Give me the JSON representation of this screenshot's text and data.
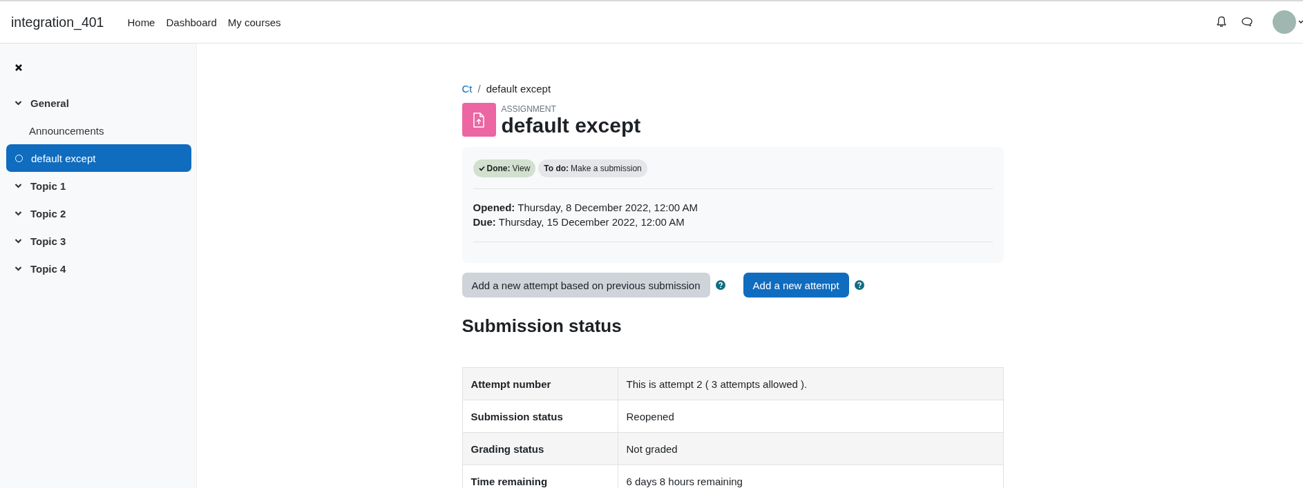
{
  "navbar": {
    "site_name": "integration_401",
    "links": [
      {
        "label": "Home"
      },
      {
        "label": "Dashboard"
      },
      {
        "label": "My courses"
      }
    ]
  },
  "course_index": {
    "sections": [
      {
        "label": "General",
        "expanded": true,
        "children": [
          {
            "label": "Announcements",
            "selected": false,
            "kind": "plain"
          },
          {
            "label": "default except",
            "selected": true,
            "kind": "activity"
          }
        ]
      },
      {
        "label": "Topic 1",
        "expanded": true
      },
      {
        "label": "Topic 2",
        "expanded": true
      },
      {
        "label": "Topic 3",
        "expanded": true
      },
      {
        "label": "Topic 4",
        "expanded": true
      }
    ]
  },
  "breadcrumb": {
    "separator": "/",
    "items": [
      {
        "label": "Ct",
        "link": true
      },
      {
        "label": "default except",
        "link": false
      }
    ]
  },
  "activity": {
    "type_label": "ASSIGNMENT",
    "title": "default except"
  },
  "completion": [
    {
      "label": "Done:",
      "text": "View",
      "done": true
    },
    {
      "label": "To do:",
      "text": "Make a submission",
      "done": false
    }
  ],
  "dates": [
    {
      "label": "Opened:",
      "value": "Thursday, 8 December 2022, 12:00 AM"
    },
    {
      "label": "Due:",
      "value": "Thursday, 15 December 2022, 12:00 AM"
    }
  ],
  "actions": [
    {
      "label": "Add a new attempt based on previous submission",
      "kind": "secondary"
    },
    {
      "label": "Add a new attempt",
      "kind": "primary"
    }
  ],
  "submission_heading": "Submission status",
  "submission_table": {
    "rows": [
      {
        "label": "Attempt number",
        "value": "This is attempt 2 ( 3 attempts allowed )."
      },
      {
        "label": "Submission status",
        "value": "Reopened"
      },
      {
        "label": "Grading status",
        "value": "Not graded"
      },
      {
        "label": "Time remaining",
        "value": "6 days 8 hours remaining"
      }
    ]
  }
}
